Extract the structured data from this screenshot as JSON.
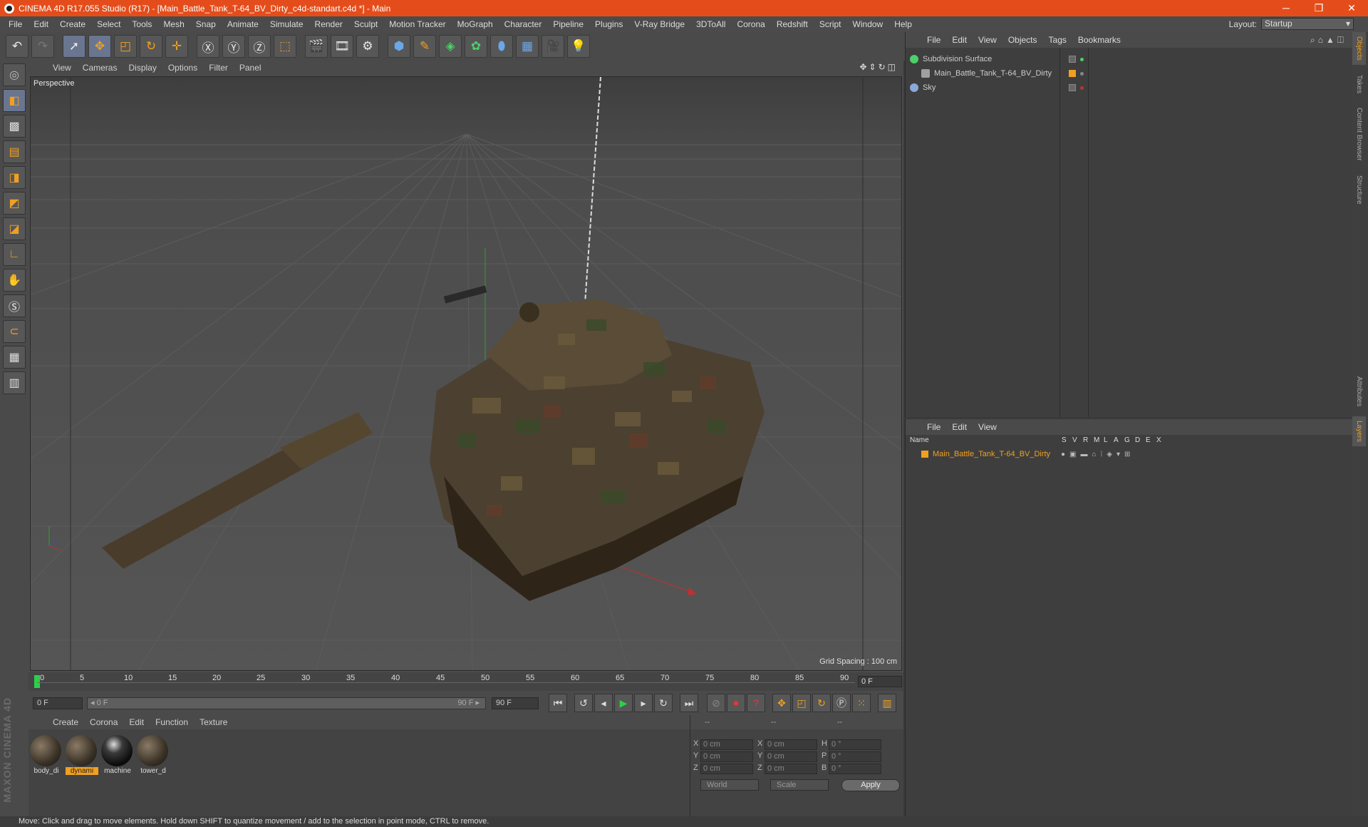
{
  "window": {
    "title": "CINEMA 4D R17.055 Studio (R17) - [Main_Battle_Tank_T-64_BV_Dirty_c4d-standart.c4d *] - Main",
    "controls": [
      "─",
      "❐",
      "✕"
    ]
  },
  "menu": [
    "File",
    "Edit",
    "Create",
    "Select",
    "Tools",
    "Mesh",
    "Snap",
    "Animate",
    "Simulate",
    "Render",
    "Sculpt",
    "Motion Tracker",
    "MoGraph",
    "Character",
    "Pipeline",
    "Plugins",
    "V-Ray Bridge",
    "3DToAll",
    "Corona",
    "Redshift",
    "Script",
    "Window",
    "Help"
  ],
  "layout": {
    "label": "Layout:",
    "value": "Startup"
  },
  "toolbar_icons": [
    "undo-icon",
    "redo-icon",
    "select-arrow-icon",
    "move-icon",
    "scale-icon",
    "rotate-icon",
    "live-select-icon",
    "x-axis-icon",
    "y-axis-icon",
    "z-axis-icon",
    "world-coord-icon",
    "render-view-icon",
    "render-picture-viewer-icon",
    "render-settings-icon",
    "cube-icon",
    "pen-spline-icon",
    "subdivision-icon",
    "cloner-icon",
    "deformer-icon",
    "floor-icon",
    "camera-icon",
    "light-icon"
  ],
  "viewport": {
    "menu": [
      "View",
      "Cameras",
      "Display",
      "Options",
      "Filter",
      "Panel"
    ],
    "label": "Perspective",
    "grid_spacing": "Grid Spacing : 100 cm"
  },
  "timeline": {
    "ticks": [
      "0",
      "5",
      "10",
      "15",
      "20",
      "25",
      "30",
      "35",
      "40",
      "45",
      "50",
      "55",
      "60",
      "65",
      "70",
      "75",
      "80",
      "85",
      "90"
    ],
    "current_frame": "0 F"
  },
  "transport": {
    "start_field": "0 F",
    "slider_start": "◂ 0 F",
    "slider_end": "90 F ▸",
    "end_field": "90 F"
  },
  "materials": {
    "menu": [
      "Create",
      "Corona",
      "Edit",
      "Function",
      "Texture"
    ],
    "items": [
      {
        "name": "body_di",
        "selected": false
      },
      {
        "name": "dynami",
        "selected": true
      },
      {
        "name": "machine",
        "selected": false
      },
      {
        "name": "tower_d",
        "selected": false
      }
    ]
  },
  "coordinates": {
    "headers": [
      "--",
      "--",
      "--"
    ],
    "rows": [
      {
        "a": "X",
        "v1": "0 cm",
        "b": "X",
        "v2": "0 cm",
        "c": "H",
        "v3": "0 °"
      },
      {
        "a": "Y",
        "v1": "0 cm",
        "b": "Y",
        "v2": "0 cm",
        "c": "P",
        "v3": "0 °"
      },
      {
        "a": "Z",
        "v1": "0 cm",
        "b": "Z",
        "v2": "0 cm",
        "c": "B",
        "v3": "0 °"
      }
    ],
    "mode": "World",
    "size_mode": "Scale",
    "apply": "Apply"
  },
  "objects": {
    "menu": [
      "File",
      "Edit",
      "View",
      "Objects",
      "Tags",
      "Bookmarks"
    ],
    "items": [
      {
        "name": "Subdivision Surface",
        "color": "#4cd068"
      },
      {
        "name": "Main_Battle_Tank_T-64_BV_Dirty",
        "color": "#a0a0a0"
      },
      {
        "name": "Sky",
        "color": "#8aa8d8"
      }
    ]
  },
  "layers": {
    "menu": [
      "File",
      "Edit",
      "View"
    ],
    "columns": [
      "Name",
      "S",
      "V",
      "R",
      "M",
      "L",
      "A",
      "G",
      "D",
      "E",
      "X"
    ],
    "item": "Main_Battle_Tank_T-64_BV_Dirty",
    "color": "#f0a020"
  },
  "side_tabs": [
    "Objects",
    "Takes",
    "Content Browser",
    "Structure",
    "Attributes",
    "Layers"
  ],
  "status": "Move: Click and drag to move elements. Hold down SHIFT to quantize movement / add to the selection in point mode, CTRL to remove.",
  "branding": "MAXON CINEMA 4D"
}
